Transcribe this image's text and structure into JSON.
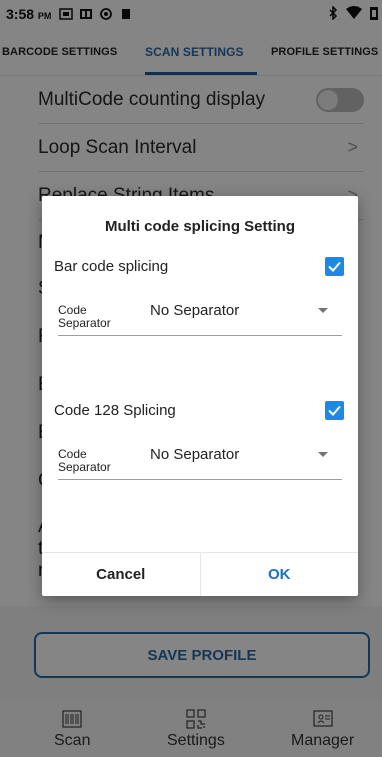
{
  "status_bar": {
    "time": "3:58",
    "ampm": "PM"
  },
  "tabs": [
    {
      "label": "BARCODE SETTINGS",
      "active": false
    },
    {
      "label": "SCAN SETTINGS",
      "active": true
    },
    {
      "label": "PROFILE SETTINGS",
      "active": false
    }
  ],
  "settings_list": {
    "items": [
      {
        "label": "MultiCode counting display",
        "control": "toggle",
        "on": false
      },
      {
        "label": "Loop Scan Interval",
        "control": "chevron"
      },
      {
        "label": "Replace String Items",
        "control": "chevron"
      }
    ],
    "partial_letters": [
      "M",
      "S",
      "F",
      "E",
      "E",
      "C",
      "A",
      "t",
      "r"
    ]
  },
  "dialog": {
    "title": "Multi code splicing Setting",
    "sections": [
      {
        "label": "Bar code splicing",
        "checked": true,
        "separator_label": "Code Separator",
        "separator_value": "No Separator"
      },
      {
        "label": "Code 128 Splicing",
        "checked": true,
        "separator_label": "Code Separator",
        "separator_value": "No Separator"
      }
    ],
    "cancel_label": "Cancel",
    "ok_label": "OK"
  },
  "save_profile_label": "SAVE PROFILE",
  "bottom_nav": [
    {
      "label": "Scan",
      "icon": "barcode-icon"
    },
    {
      "label": "Settings",
      "icon": "qr-code-icon"
    },
    {
      "label": "Manager",
      "icon": "id-card-icon"
    }
  ],
  "colors": {
    "accent": "#2a6aa8",
    "checkbox": "#1e88e5",
    "ok": "#1e6fc0"
  }
}
